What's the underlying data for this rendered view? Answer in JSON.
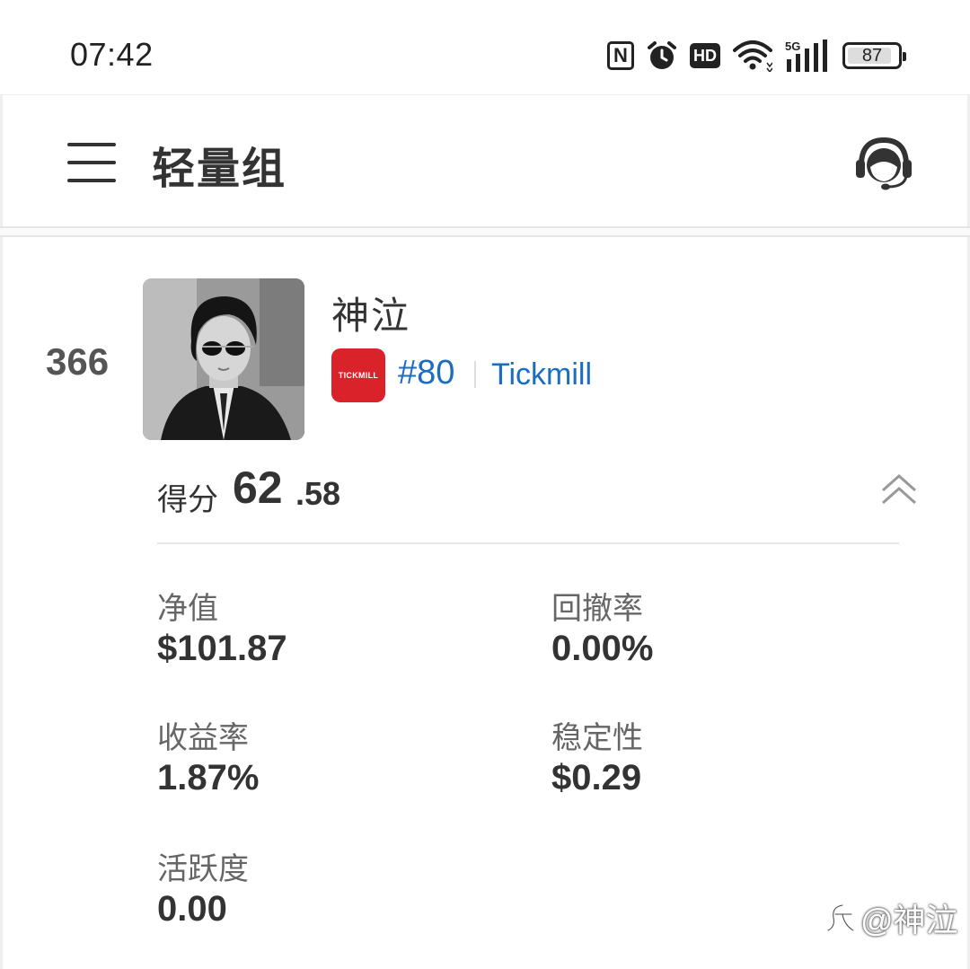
{
  "status_bar": {
    "time": "07:42",
    "icons": [
      "nfc-icon",
      "alarm-icon",
      "hd-icon",
      "wifi-icon",
      "5g-signal-icon",
      "battery-icon"
    ],
    "hd_text": "HD",
    "nfc_text": "N",
    "network": "5G",
    "battery": "87"
  },
  "header": {
    "title": "轻量组",
    "menu_icon": "hamburger-menu-icon",
    "support_icon": "customer-service-icon"
  },
  "trader": {
    "rank": "366",
    "name": "神泣",
    "broker_logo_text": "TICKMILL",
    "broker_rank": "#80",
    "broker_name": "Tickmill"
  },
  "score": {
    "label": "得分",
    "integer": "62",
    "decimal": ".58"
  },
  "stats": [
    {
      "label": "净值",
      "value": "$101.87"
    },
    {
      "label": "回撤率",
      "value": "0.00%"
    },
    {
      "label": "收益率",
      "value": "1.87%"
    },
    {
      "label": "稳定性",
      "value": "$0.29"
    },
    {
      "label": "活跃度",
      "value": "0.00"
    }
  ],
  "watermark": "@神泣",
  "colors": {
    "accent_blue": "#1a6dbf",
    "broker_red": "#d9222a",
    "text_dark": "#333333",
    "text_label": "#666666"
  }
}
